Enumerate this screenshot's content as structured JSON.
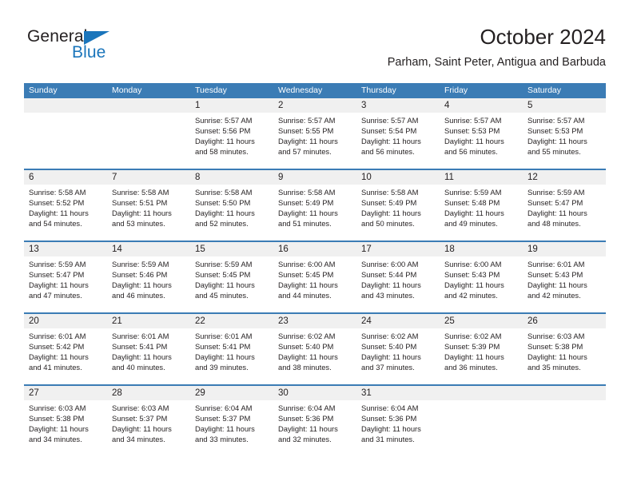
{
  "brand": {
    "name_dark": "General",
    "name_blue": "Blue",
    "accent_color": "#1a75bb"
  },
  "header": {
    "title": "October 2024",
    "subtitle": "Parham, Saint Peter, Antigua and Barbuda"
  },
  "theme": {
    "header_band": "#3b7cb5",
    "date_band": "#f0f0f0",
    "text": "#231f20"
  },
  "weekday_headers": [
    "Sunday",
    "Monday",
    "Tuesday",
    "Wednesday",
    "Thursday",
    "Friday",
    "Saturday"
  ],
  "weeks": [
    {
      "days": [
        {
          "num": "",
          "sunrise": "",
          "sunset": "",
          "daylight1": "",
          "daylight2": ""
        },
        {
          "num": "",
          "sunrise": "",
          "sunset": "",
          "daylight1": "",
          "daylight2": ""
        },
        {
          "num": "1",
          "sunrise": "Sunrise: 5:57 AM",
          "sunset": "Sunset: 5:56 PM",
          "daylight1": "Daylight: 11 hours",
          "daylight2": "and 58 minutes."
        },
        {
          "num": "2",
          "sunrise": "Sunrise: 5:57 AM",
          "sunset": "Sunset: 5:55 PM",
          "daylight1": "Daylight: 11 hours",
          "daylight2": "and 57 minutes."
        },
        {
          "num": "3",
          "sunrise": "Sunrise: 5:57 AM",
          "sunset": "Sunset: 5:54 PM",
          "daylight1": "Daylight: 11 hours",
          "daylight2": "and 56 minutes."
        },
        {
          "num": "4",
          "sunrise": "Sunrise: 5:57 AM",
          "sunset": "Sunset: 5:53 PM",
          "daylight1": "Daylight: 11 hours",
          "daylight2": "and 56 minutes."
        },
        {
          "num": "5",
          "sunrise": "Sunrise: 5:57 AM",
          "sunset": "Sunset: 5:53 PM",
          "daylight1": "Daylight: 11 hours",
          "daylight2": "and 55 minutes."
        }
      ]
    },
    {
      "days": [
        {
          "num": "6",
          "sunrise": "Sunrise: 5:58 AM",
          "sunset": "Sunset: 5:52 PM",
          "daylight1": "Daylight: 11 hours",
          "daylight2": "and 54 minutes."
        },
        {
          "num": "7",
          "sunrise": "Sunrise: 5:58 AM",
          "sunset": "Sunset: 5:51 PM",
          "daylight1": "Daylight: 11 hours",
          "daylight2": "and 53 minutes."
        },
        {
          "num": "8",
          "sunrise": "Sunrise: 5:58 AM",
          "sunset": "Sunset: 5:50 PM",
          "daylight1": "Daylight: 11 hours",
          "daylight2": "and 52 minutes."
        },
        {
          "num": "9",
          "sunrise": "Sunrise: 5:58 AM",
          "sunset": "Sunset: 5:49 PM",
          "daylight1": "Daylight: 11 hours",
          "daylight2": "and 51 minutes."
        },
        {
          "num": "10",
          "sunrise": "Sunrise: 5:58 AM",
          "sunset": "Sunset: 5:49 PM",
          "daylight1": "Daylight: 11 hours",
          "daylight2": "and 50 minutes."
        },
        {
          "num": "11",
          "sunrise": "Sunrise: 5:59 AM",
          "sunset": "Sunset: 5:48 PM",
          "daylight1": "Daylight: 11 hours",
          "daylight2": "and 49 minutes."
        },
        {
          "num": "12",
          "sunrise": "Sunrise: 5:59 AM",
          "sunset": "Sunset: 5:47 PM",
          "daylight1": "Daylight: 11 hours",
          "daylight2": "and 48 minutes."
        }
      ]
    },
    {
      "days": [
        {
          "num": "13",
          "sunrise": "Sunrise: 5:59 AM",
          "sunset": "Sunset: 5:47 PM",
          "daylight1": "Daylight: 11 hours",
          "daylight2": "and 47 minutes."
        },
        {
          "num": "14",
          "sunrise": "Sunrise: 5:59 AM",
          "sunset": "Sunset: 5:46 PM",
          "daylight1": "Daylight: 11 hours",
          "daylight2": "and 46 minutes."
        },
        {
          "num": "15",
          "sunrise": "Sunrise: 5:59 AM",
          "sunset": "Sunset: 5:45 PM",
          "daylight1": "Daylight: 11 hours",
          "daylight2": "and 45 minutes."
        },
        {
          "num": "16",
          "sunrise": "Sunrise: 6:00 AM",
          "sunset": "Sunset: 5:45 PM",
          "daylight1": "Daylight: 11 hours",
          "daylight2": "and 44 minutes."
        },
        {
          "num": "17",
          "sunrise": "Sunrise: 6:00 AM",
          "sunset": "Sunset: 5:44 PM",
          "daylight1": "Daylight: 11 hours",
          "daylight2": "and 43 minutes."
        },
        {
          "num": "18",
          "sunrise": "Sunrise: 6:00 AM",
          "sunset": "Sunset: 5:43 PM",
          "daylight1": "Daylight: 11 hours",
          "daylight2": "and 42 minutes."
        },
        {
          "num": "19",
          "sunrise": "Sunrise: 6:01 AM",
          "sunset": "Sunset: 5:43 PM",
          "daylight1": "Daylight: 11 hours",
          "daylight2": "and 42 minutes."
        }
      ]
    },
    {
      "days": [
        {
          "num": "20",
          "sunrise": "Sunrise: 6:01 AM",
          "sunset": "Sunset: 5:42 PM",
          "daylight1": "Daylight: 11 hours",
          "daylight2": "and 41 minutes."
        },
        {
          "num": "21",
          "sunrise": "Sunrise: 6:01 AM",
          "sunset": "Sunset: 5:41 PM",
          "daylight1": "Daylight: 11 hours",
          "daylight2": "and 40 minutes."
        },
        {
          "num": "22",
          "sunrise": "Sunrise: 6:01 AM",
          "sunset": "Sunset: 5:41 PM",
          "daylight1": "Daylight: 11 hours",
          "daylight2": "and 39 minutes."
        },
        {
          "num": "23",
          "sunrise": "Sunrise: 6:02 AM",
          "sunset": "Sunset: 5:40 PM",
          "daylight1": "Daylight: 11 hours",
          "daylight2": "and 38 minutes."
        },
        {
          "num": "24",
          "sunrise": "Sunrise: 6:02 AM",
          "sunset": "Sunset: 5:40 PM",
          "daylight1": "Daylight: 11 hours",
          "daylight2": "and 37 minutes."
        },
        {
          "num": "25",
          "sunrise": "Sunrise: 6:02 AM",
          "sunset": "Sunset: 5:39 PM",
          "daylight1": "Daylight: 11 hours",
          "daylight2": "and 36 minutes."
        },
        {
          "num": "26",
          "sunrise": "Sunrise: 6:03 AM",
          "sunset": "Sunset: 5:38 PM",
          "daylight1": "Daylight: 11 hours",
          "daylight2": "and 35 minutes."
        }
      ]
    },
    {
      "days": [
        {
          "num": "27",
          "sunrise": "Sunrise: 6:03 AM",
          "sunset": "Sunset: 5:38 PM",
          "daylight1": "Daylight: 11 hours",
          "daylight2": "and 34 minutes."
        },
        {
          "num": "28",
          "sunrise": "Sunrise: 6:03 AM",
          "sunset": "Sunset: 5:37 PM",
          "daylight1": "Daylight: 11 hours",
          "daylight2": "and 34 minutes."
        },
        {
          "num": "29",
          "sunrise": "Sunrise: 6:04 AM",
          "sunset": "Sunset: 5:37 PM",
          "daylight1": "Daylight: 11 hours",
          "daylight2": "and 33 minutes."
        },
        {
          "num": "30",
          "sunrise": "Sunrise: 6:04 AM",
          "sunset": "Sunset: 5:36 PM",
          "daylight1": "Daylight: 11 hours",
          "daylight2": "and 32 minutes."
        },
        {
          "num": "31",
          "sunrise": "Sunrise: 6:04 AM",
          "sunset": "Sunset: 5:36 PM",
          "daylight1": "Daylight: 11 hours",
          "daylight2": "and 31 minutes."
        },
        {
          "num": "",
          "sunrise": "",
          "sunset": "",
          "daylight1": "",
          "daylight2": ""
        },
        {
          "num": "",
          "sunrise": "",
          "sunset": "",
          "daylight1": "",
          "daylight2": ""
        }
      ]
    }
  ]
}
